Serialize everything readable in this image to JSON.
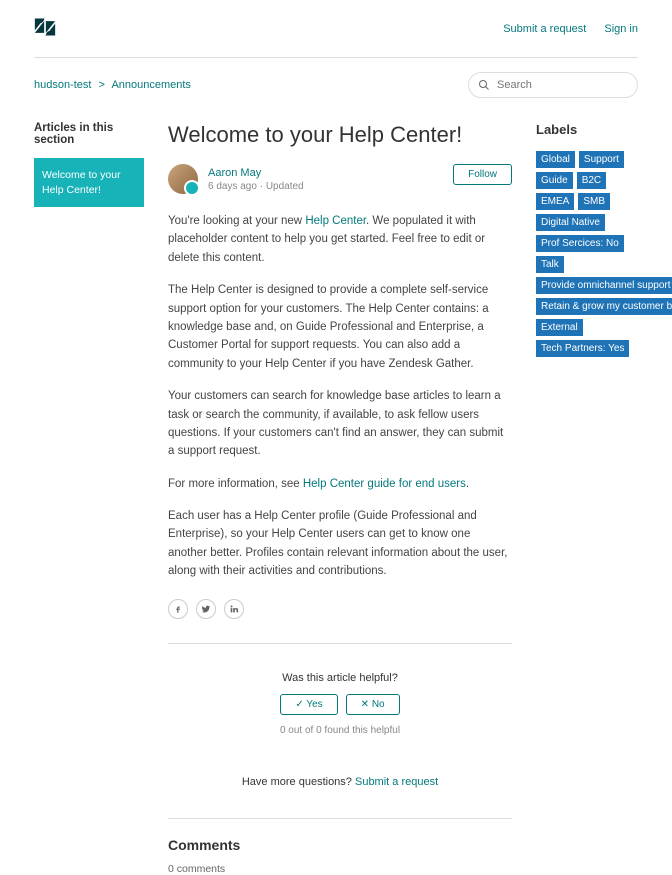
{
  "header": {
    "submit": "Submit a request",
    "signin": "Sign in"
  },
  "breadcrumb": {
    "root": "hudson-test",
    "section": "Announcements"
  },
  "search": {
    "placeholder": "Search"
  },
  "sidebar": {
    "heading": "Articles in this section",
    "items": [
      "Welcome to your Help Center!"
    ]
  },
  "article": {
    "title": "Welcome to your Help Center!",
    "author": "Aaron May",
    "meta": "6 days ago · Updated",
    "follow": "Follow",
    "p1a": "You're looking at your new ",
    "p1link": "Help Center",
    "p1b": ". We populated it with placeholder content to help you get started. Feel free to edit or delete this content.",
    "p2": "The Help Center is designed to provide a complete self-service support option for your customers. The Help Center contains: a knowledge base and, on Guide Professional and Enterprise, a Customer Portal for support requests. You can also add a community to your Help Center if you have Zendesk Gather.",
    "p3": "Your customers can search for knowledge base articles to learn a task or search the community, if available, to ask fellow users questions. If your customers can't find an answer, they can submit a support request.",
    "p4a": "For more information, see ",
    "p4link": "Help Center guide for end users",
    "p4b": ".",
    "p5": "Each user has a Help Center profile (Guide Professional and Enterprise), so your Help Center users can get to know one another better. Profiles contain relevant information about the user, along with their activities and contributions."
  },
  "helpful": {
    "question": "Was this article helpful?",
    "yes": "✓   Yes",
    "no": "✕   No",
    "count": "0 out of 0 found this helpful"
  },
  "moreq": {
    "text": "Have more questions? ",
    "link": "Submit a request"
  },
  "comments": {
    "heading": "Comments",
    "count": "0 comments"
  },
  "labels": {
    "heading": "Labels",
    "tags": [
      "Global",
      "Support",
      "Guide",
      "B2C",
      "EMEA",
      "SMB",
      "Digital Native",
      "Prof Sercices: No",
      "Talk",
      "Provide omnichannel support",
      "Retain & grow my customer base",
      "External",
      "Tech Partners: Yes"
    ]
  }
}
